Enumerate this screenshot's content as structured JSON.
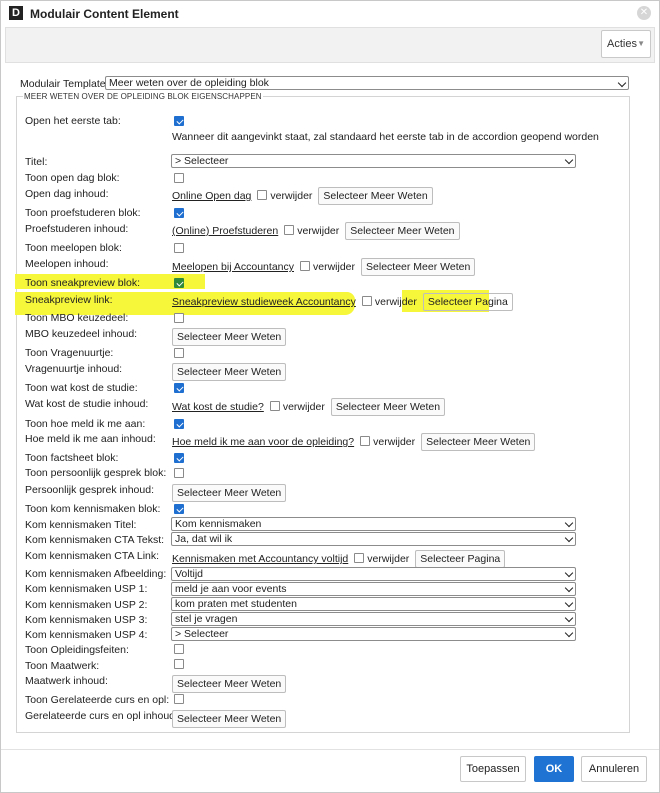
{
  "window": {
    "title": "Modulair Content Element",
    "logo_letter": "D"
  },
  "toolbar": {
    "acties_label": "Acties"
  },
  "template": {
    "label": "Modulair Template:",
    "value": "Meer weten over de opleiding blok"
  },
  "fieldset": {
    "legend": "MEER WETEN OVER DE OPLEIDING BLOK EIGENSCHAPPEN"
  },
  "fields": {
    "open_tab": {
      "label": "Open het eerste tab:",
      "checked": true,
      "help": "Wanneer dit aangevinkt staat, zal standaard het eerste tab in de accordion geopend worden"
    },
    "titel": {
      "label": "Titel:",
      "value": "> Selecteer"
    },
    "toon_open_dag": {
      "label": "Toon open dag blok:",
      "checked": false
    },
    "open_dag_inhoud": {
      "label": "Open dag inhoud:",
      "link": "Online Open dag",
      "remove": "verwijder",
      "button": "Selecteer Meer Weten"
    },
    "toon_proefstuderen": {
      "label": "Toon proefstuderen blok:",
      "checked": true
    },
    "proefstuderen_inhoud": {
      "label": "Proefstuderen inhoud:",
      "link": "(Online) Proefstuderen",
      "remove": "verwijder",
      "button": "Selecteer Meer Weten"
    },
    "toon_meelopen": {
      "label": "Toon meelopen blok:",
      "checked": false
    },
    "meelopen_inhoud": {
      "label": "Meelopen inhoud:",
      "link": "Meelopen bij Accountancy",
      "remove": "verwijder",
      "button": "Selecteer Meer Weten"
    },
    "toon_sneakpreview": {
      "label": "Toon sneakpreview blok:",
      "checked": true
    },
    "sneakpreview_link": {
      "label": "Sneakpreview link:",
      "link": "Sneakpreview studieweek Accountancy",
      "remove": "verwijder",
      "button": "Selecteer Pagina"
    },
    "toon_mbo": {
      "label": "Toon MBO keuzedeel:",
      "checked": false
    },
    "mbo_inhoud": {
      "label": "MBO keuzedeel inhoud:",
      "button": "Selecteer Meer Weten"
    },
    "toon_vragenuurtje": {
      "label": "Toon Vragenuurtje:",
      "checked": false
    },
    "vragenuurtje_inhoud": {
      "label": "Vragenuurtje inhoud:",
      "button": "Selecteer Meer Weten"
    },
    "toon_wat_kost": {
      "label": "Toon wat kost de studie:",
      "checked": true
    },
    "wat_kost_inhoud": {
      "label": "Wat kost de studie inhoud:",
      "link": "Wat kost de studie?",
      "remove": "verwijder",
      "button": "Selecteer Meer Weten"
    },
    "toon_hoe_meld": {
      "label": "Toon hoe meld ik me aan:",
      "checked": true
    },
    "hoe_meld_inhoud": {
      "label": "Hoe meld ik me aan inhoud:",
      "link": "Hoe meld ik me aan voor de opleiding?",
      "remove": "verwijder",
      "button": "Selecteer Meer Weten"
    },
    "toon_factsheet": {
      "label": "Toon factsheet blok:",
      "checked": true
    },
    "toon_persoonlijk": {
      "label": "Toon persoonlijk gesprek blok:",
      "checked": false
    },
    "persoonlijk_inhoud": {
      "label": "Persoonlijk gesprek inhoud:",
      "button": "Selecteer Meer Weten"
    },
    "toon_kom_kennismaken": {
      "label": "Toon kom kennismaken blok:",
      "checked": true
    },
    "kom_titel": {
      "label": "Kom kennismaken Titel:",
      "value": "Kom kennismaken"
    },
    "kom_cta_tekst": {
      "label": "Kom kennismaken CTA Tekst:",
      "value": "Ja, dat wil ik"
    },
    "kom_cta_link": {
      "label": "Kom kennismaken CTA Link:",
      "link": "Kennismaken met Accountancy voltijd",
      "remove": "verwijder",
      "button": "Selecteer Pagina"
    },
    "kom_afbeelding": {
      "label": "Kom kennismaken Afbeelding:",
      "value": "Voltijd"
    },
    "kom_usp1": {
      "label": "Kom kennismaken USP 1:",
      "value": "meld je aan voor events"
    },
    "kom_usp2": {
      "label": "Kom kennismaken USP 2:",
      "value": "kom praten met studenten"
    },
    "kom_usp3": {
      "label": "Kom kennismaken USP 3:",
      "value": "stel je vragen"
    },
    "kom_usp4": {
      "label": "Kom kennismaken USP 4:",
      "value": "> Selecteer"
    },
    "toon_opleidingsfeiten": {
      "label": "Toon Opleidingsfeiten:",
      "checked": false
    },
    "toon_maatwerk": {
      "label": "Toon Maatwerk:",
      "checked": false
    },
    "maatwerk_inhoud": {
      "label": "Maatwerk inhoud:",
      "button": "Selecteer Meer Weten"
    },
    "toon_gerelateerde": {
      "label": "Toon Gerelateerde curs en opl:",
      "checked": false
    },
    "gerelateerde_inhoud": {
      "label": "Gerelateerde curs en opl inhoud:",
      "button": "Selecteer Meer Weten"
    }
  },
  "footer": {
    "apply": "Toepassen",
    "ok": "OK",
    "cancel": "Annuleren"
  },
  "colors": {
    "highlight": "#f6f63a",
    "primary": "#1f73d2",
    "checkbox": "#1f6fd1"
  }
}
